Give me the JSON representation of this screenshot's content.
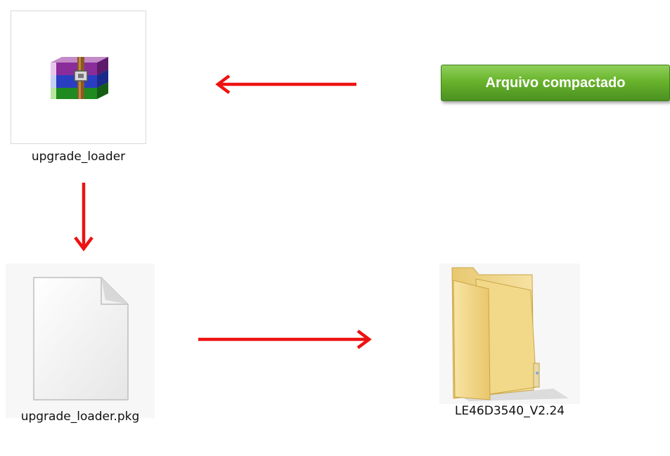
{
  "files": {
    "archive": {
      "name": "upgrade_loader",
      "icon": "winrar-archive-icon"
    },
    "package": {
      "name": "upgrade_loader.pkg",
      "icon": "blank-file-icon"
    },
    "folder": {
      "name": "LE46D3540_V2.24",
      "icon": "folder-icon"
    }
  },
  "callout": {
    "label": "Arquivo compactado",
    "color": "#69b32c"
  },
  "arrows": {
    "color": "#ee1111"
  }
}
